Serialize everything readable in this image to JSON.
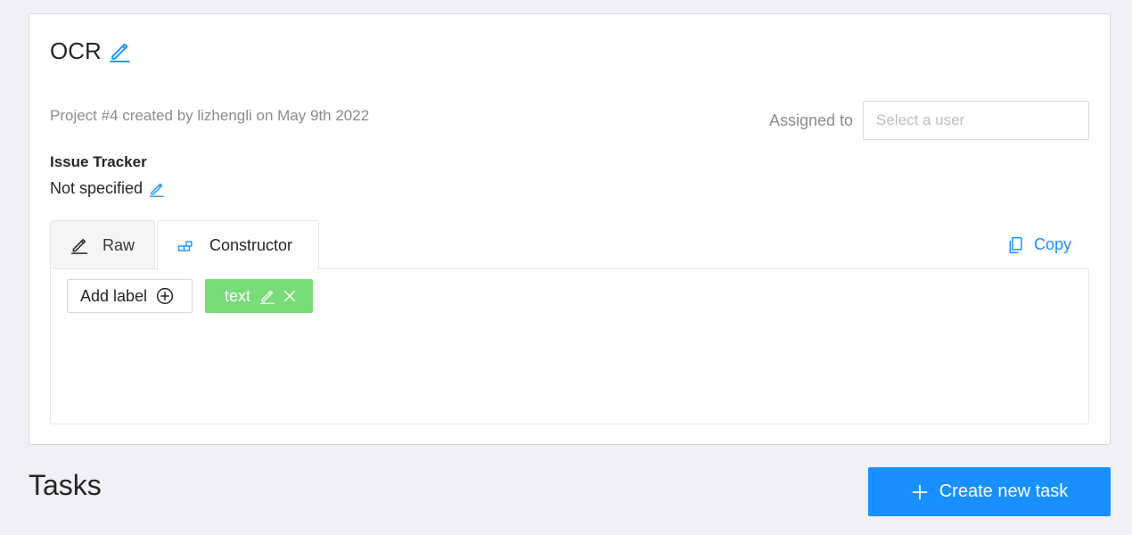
{
  "project": {
    "title": "OCR",
    "meta": "Project #4 created by lizhengli on May 9th 2022",
    "assignee_label": "Assigned to",
    "assignee_placeholder": "Select a user",
    "issue_tracker_title": "Issue Tracker",
    "issue_tracker_value": "Not specified"
  },
  "tabs": [
    {
      "label": "Raw",
      "icon": "edit-icon",
      "active": false
    },
    {
      "label": "Constructor",
      "icon": "constructor-icon",
      "active": true
    }
  ],
  "copy_label": "Copy",
  "labels_panel": {
    "add_label": "Add label",
    "labels": [
      {
        "name": "text",
        "color": "#78dc78"
      }
    ]
  },
  "tasks": {
    "title": "Tasks",
    "create_button": "Create new task"
  },
  "colors": {
    "accent": "#1890ff",
    "label_green": "#78dc78",
    "background": "#f0f1f4"
  }
}
